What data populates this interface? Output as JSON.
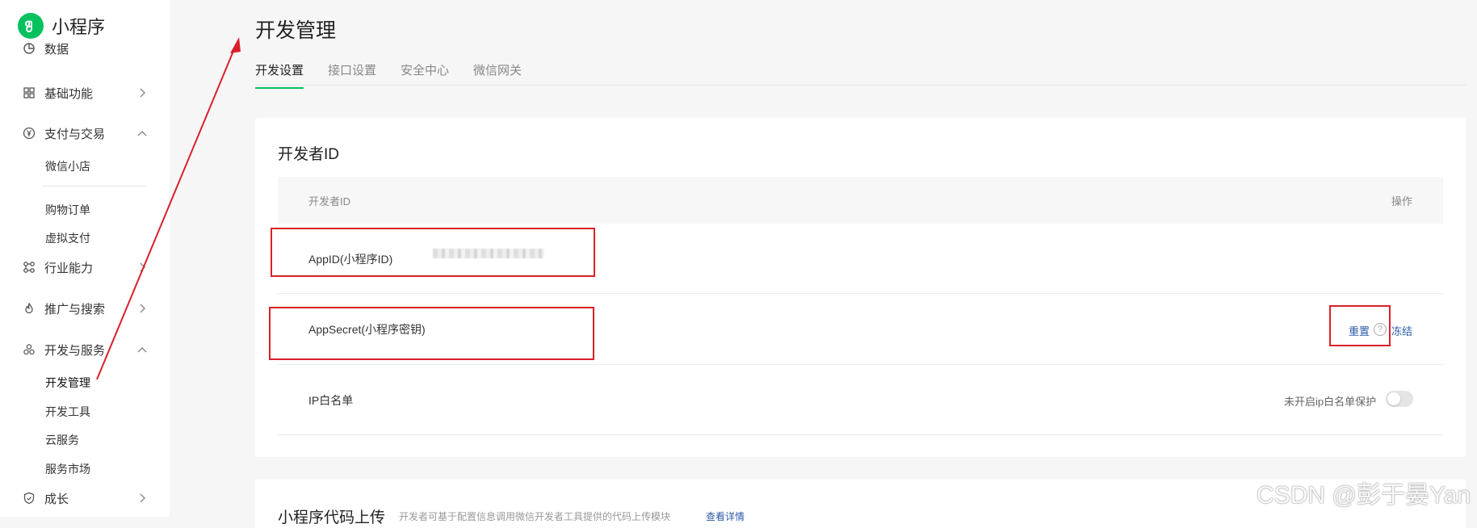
{
  "brand": {
    "title": "小程序",
    "accent": "#07c160"
  },
  "sidebar": {
    "items": [
      {
        "label": "数据",
        "icon": "chart-icon"
      },
      {
        "label": "基础功能",
        "icon": "grid-icon"
      },
      {
        "label": "支付与交易",
        "icon": "yen-icon"
      },
      {
        "label": "行业能力",
        "icon": "nodes-icon"
      },
      {
        "label": "推广与搜索",
        "icon": "flame-icon"
      },
      {
        "label": "开发与服务",
        "icon": "cluster-icon"
      },
      {
        "label": "成长",
        "icon": "shield-icon"
      }
    ],
    "pay_sub": [
      "微信小店",
      "购物订单",
      "虚拟支付"
    ],
    "dev_sub": [
      "开发管理",
      "开发工具",
      "云服务",
      "服务市场"
    ]
  },
  "main": {
    "title": "开发管理",
    "tabs": [
      "开发设置",
      "接口设置",
      "安全中心",
      "微信网关"
    ],
    "dev_id": {
      "title": "开发者ID",
      "col_id": "开发者ID",
      "col_op": "操作",
      "appid_label": "AppID(小程序ID)",
      "secret_label": "AppSecret(小程序密钥)",
      "reset": "重置",
      "freeze": "冻结",
      "ip_label": "IP白名单",
      "ip_status": "未开启ip白名单保护",
      "ip_protection_on": false
    },
    "upload": {
      "title": "小程序代码上传",
      "desc": "开发者可基于配置信息调用微信开发者工具提供的代码上传模块",
      "link": "查看详情"
    }
  },
  "watermark": "CSDN @彭于晏Yan",
  "annotation_color": "#d9202a"
}
